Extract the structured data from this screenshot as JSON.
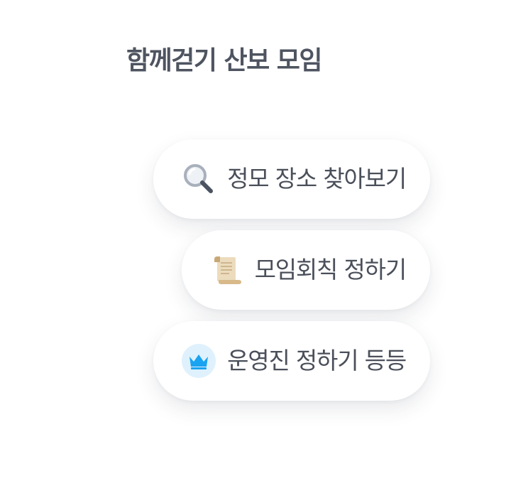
{
  "header": {
    "title": "함께걷기 산보 모임"
  },
  "features": [
    {
      "label": "정모 장소 찾아보기",
      "icon": "magnifier-icon"
    },
    {
      "label": "모임회칙 정하기",
      "icon": "scroll-icon"
    },
    {
      "label": "운영진 정하기 등등",
      "icon": "crown-icon"
    }
  ],
  "colors": {
    "title": "#4e5460",
    "label": "#4a4f5a",
    "crown": "#1aa3f0",
    "crown_bg": "#dff1fc",
    "scroll": "#e6d2ad"
  }
}
